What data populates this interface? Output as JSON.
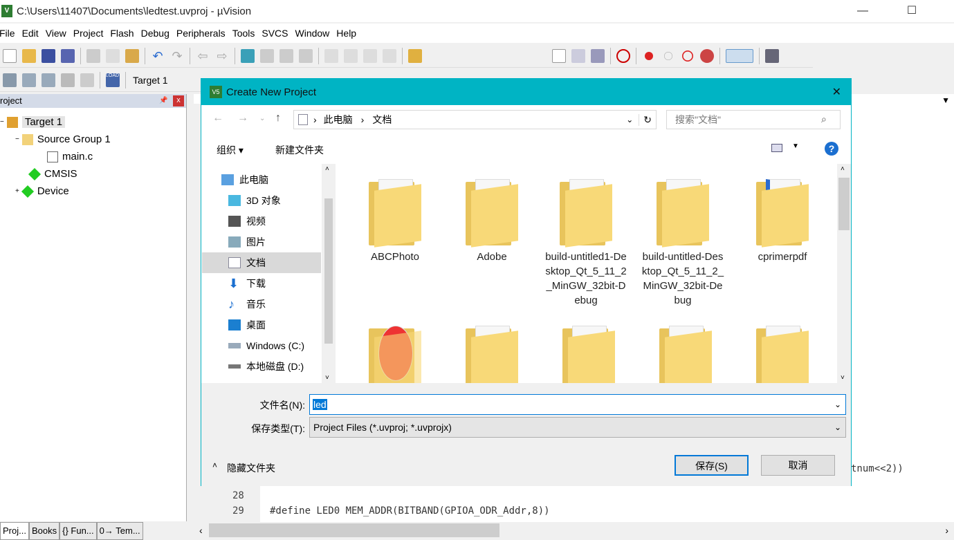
{
  "window": {
    "title": "C:\\Users\\11407\\Documents\\ledtest.uvproj - µVision",
    "minimize": "—",
    "maximize": "☐"
  },
  "menu": [
    "File",
    "Edit",
    "View",
    "Project",
    "Flash",
    "Debug",
    "Peripherals",
    "Tools",
    "SVCS",
    "Window",
    "Help"
  ],
  "toolbar2": {
    "target": "Target 1"
  },
  "project_panel": {
    "title": "roject",
    "pin": "📌",
    "close": "x",
    "tree": [
      {
        "label": "Target 1",
        "expander": "−"
      },
      {
        "label": "Source Group 1",
        "expander": "−"
      },
      {
        "label": "main.c"
      },
      {
        "label": "CMSIS"
      },
      {
        "label": "Device",
        "expander": "+"
      }
    ]
  },
  "bottom_tabs": [
    "Proj...",
    "Books",
    "{} Fun...",
    "0→ Tem..."
  ],
  "editor": {
    "lines": [
      {
        "num": "28",
        "text": ""
      },
      {
        "num": "29",
        "text": "#define LED0  MEM_ADDR(BITBAND(GPIOA_ODR_Addr,8))"
      }
    ],
    "partial_text": "tnum<<2))"
  },
  "dialog": {
    "title": "Create New Project",
    "close": "✕",
    "breadcrumb": [
      "此电脑",
      "文档"
    ],
    "search_placeholder": "搜索\"文档\"",
    "organize": "组织 ▾",
    "new_folder": "新建文件夹",
    "help": "?",
    "nav": [
      "此电脑",
      "3D 对象",
      "视频",
      "图片",
      "文档",
      "下载",
      "音乐",
      "桌面",
      "Windows (C:)",
      "本地磁盘 (D:)"
    ],
    "nav_selected": "文档",
    "files": [
      "ABCPhoto",
      "Adobe",
      "build-untitled1-Desktop_Qt_5_11_2_MinGW_32bit-Debug",
      "build-untitled-Desktop_Qt_5_11_2_MinGW_32bit-Debug",
      "cprimerpdf",
      "",
      "",
      "",
      "",
      ""
    ],
    "filename_label": "文件名(N):",
    "filename_value": "led",
    "filetype_label": "保存类型(T):",
    "filetype_value": "Project Files (*.uvproj; *.uvprojx)",
    "hide_folders": "隐藏文件夹",
    "save": "保存(S)",
    "cancel": "取消"
  },
  "colors": {
    "dialog_accent": "#00b4c4",
    "selection": "#cce8ff",
    "folder": "#f8d978"
  }
}
